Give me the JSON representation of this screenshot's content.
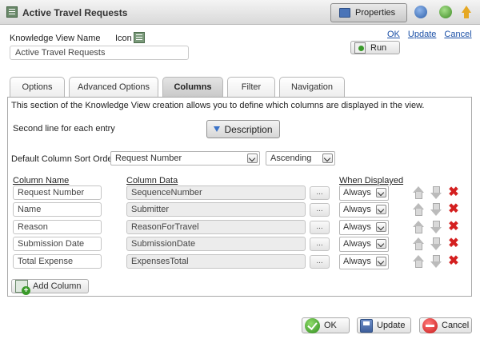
{
  "window": {
    "title": "Active Travel Requests",
    "properties_label": "Properties"
  },
  "form": {
    "kv_name_label": "Knowledge View Name",
    "icon_label": "Icon",
    "kv_name_value": "Active Travel Requests"
  },
  "links": {
    "ok": "OK",
    "update": "Update",
    "cancel": "Cancel"
  },
  "run_label": "Run",
  "tabs": [
    {
      "label": "Options",
      "active": false
    },
    {
      "label": "Advanced Options",
      "active": false
    },
    {
      "label": "Columns",
      "active": true
    },
    {
      "label": "Filter",
      "active": false
    },
    {
      "label": "Navigation",
      "active": false
    }
  ],
  "columns_panel": {
    "intro": "This section of the Knowledge View creation allows you to define which columns are displayed in the view.",
    "second_line_label": "Second line for each entry",
    "description_button": "Description",
    "sort_label": "Default Column Sort Order:",
    "sort_field": "Request Number",
    "sort_direction": "Ascending",
    "headers": {
      "column_name": "Column Name",
      "column_data": "Column Data",
      "when_displayed": "When Displayed"
    },
    "rows": [
      {
        "name": "Request Number",
        "data": "SequenceNumber",
        "ellipsis": "...",
        "when": "Always"
      },
      {
        "name": "Name",
        "data": "Submitter",
        "ellipsis": "...",
        "when": "Always"
      },
      {
        "name": "Reason",
        "data": "ReasonForTravel",
        "ellipsis": "...",
        "when": "Always"
      },
      {
        "name": "Submission Date",
        "data": "SubmissionDate",
        "ellipsis": "...",
        "when": "Always"
      },
      {
        "name": "Total Expense",
        "data": "ExpensesTotal",
        "ellipsis": "...",
        "when": "Always"
      }
    ],
    "add_column_label": "Add Column"
  },
  "footer": {
    "ok": "OK",
    "update": "Update",
    "cancel": "Cancel"
  },
  "icons": {
    "title": "list-icon",
    "properties": "properties-icon",
    "refresh": "refresh-icon",
    "recycle": "recycle-icon",
    "upload": "upload-arrow-icon",
    "run": "run-icon",
    "move_up": "move-up-icon",
    "move_down": "move-down-icon",
    "delete": "delete-icon"
  },
  "colors": {
    "link": "#1a4fa6",
    "delete": "#d42020",
    "accent_blue": "#3a72c8"
  }
}
